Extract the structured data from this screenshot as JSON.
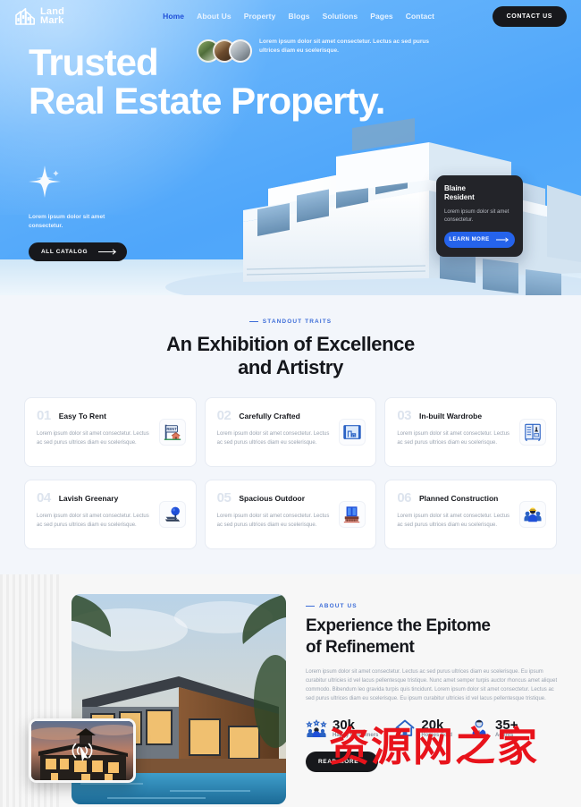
{
  "nav": {
    "logo_line1": "Land",
    "logo_line2": "Mark",
    "logo_icon": "building-icon",
    "links": [
      {
        "label": "Home",
        "active": true
      },
      {
        "label": "About Us",
        "active": false
      },
      {
        "label": "Property",
        "active": false
      },
      {
        "label": "Blogs",
        "active": false
      },
      {
        "label": "Solutions",
        "active": false
      },
      {
        "label": "Pages",
        "active": false
      },
      {
        "label": "Contact",
        "active": false
      }
    ],
    "cta_label": "CONTACT US"
  },
  "hero": {
    "headline_line1": "Trusted",
    "headline_line2": "Real Estate Property.",
    "inline_text": "Lorem ipsum dolor sit amet consectetur. Lectus ac sed purus ultrices diam eu scelerisque.",
    "promo_text": "Lorem ipsum dolor sit amet consectetur.",
    "catalog_label": "ALL CATALOG",
    "sparkle_icon": "sparkle-icon",
    "arrow_icon": "arrow-right-icon",
    "agent_card": {
      "name_line1": "Blaine",
      "name_line2": "Resident",
      "text": "Lorem ipsum dolor sit amet consectetur.",
      "button_label": "LEARN MORE"
    }
  },
  "features": {
    "eyebrow": "STANDOUT TRAITS",
    "heading_line1": "An Exhibition of Excellence",
    "heading_line2": "and Artistry",
    "body_text": "Lorem ipsum dolor sit amet consectetur. Lectus ac sed purus ultrices diam eu scelerisque.",
    "cards": [
      {
        "num": "01",
        "title": "Easy To Rent",
        "icon": "rent-sign-icon"
      },
      {
        "num": "02",
        "title": "Carefully Crafted",
        "icon": "blueprint-icon"
      },
      {
        "num": "03",
        "title": "In-built Wardrobe",
        "icon": "wardrobe-icon"
      },
      {
        "num": "04",
        "title": "Lavish Greenary",
        "icon": "tree-icon"
      },
      {
        "num": "05",
        "title": "Spacious Outdoor",
        "icon": "balcony-icon"
      },
      {
        "num": "06",
        "title": "Planned Construction",
        "icon": "construction-workers-icon"
      }
    ]
  },
  "about": {
    "eyebrow": "ABOUT US",
    "heading_line1": "Experience the Epitome",
    "heading_line2": "of Refinement",
    "paragraph": "Lorem ipsum dolor sit amet consectetur. Lectus ac sed purus ultrices diam eu scelerisque. Eu ipsum curabitur ultricies id vel lacus pellentesque tristique. Nunc amet semper turpis auctor rhoncus amet aliquet commodo. Bibendum leo gravida turpis quis tincidunt. Lorem ipsum dolor sit amet consectetur. Lectus ac sed purus ultrices diam eu scelerisque. Eu ipsum curabitur ultricies id vel lacus pellentesque tristique.",
    "stats": [
      {
        "value": "30k",
        "label": "Happy Customers",
        "icon": "customers-icon"
      },
      {
        "value": "20k",
        "label": "Homes Sold",
        "icon": "home-icon"
      },
      {
        "value": "35+",
        "label": "Agents",
        "icon": "agent-icon"
      }
    ],
    "read_more_label": "READ MORE",
    "video_icon": "signal-cursor-icon"
  },
  "watermark": {
    "text": "资源网之家",
    "color": "#e8131b"
  },
  "colors": {
    "hero_blue": "#56aefb",
    "accent_blue": "#2563eb",
    "dark": "#17181c",
    "features_bg": "#f3f6fb",
    "muted_text": "#9aa3b0"
  }
}
